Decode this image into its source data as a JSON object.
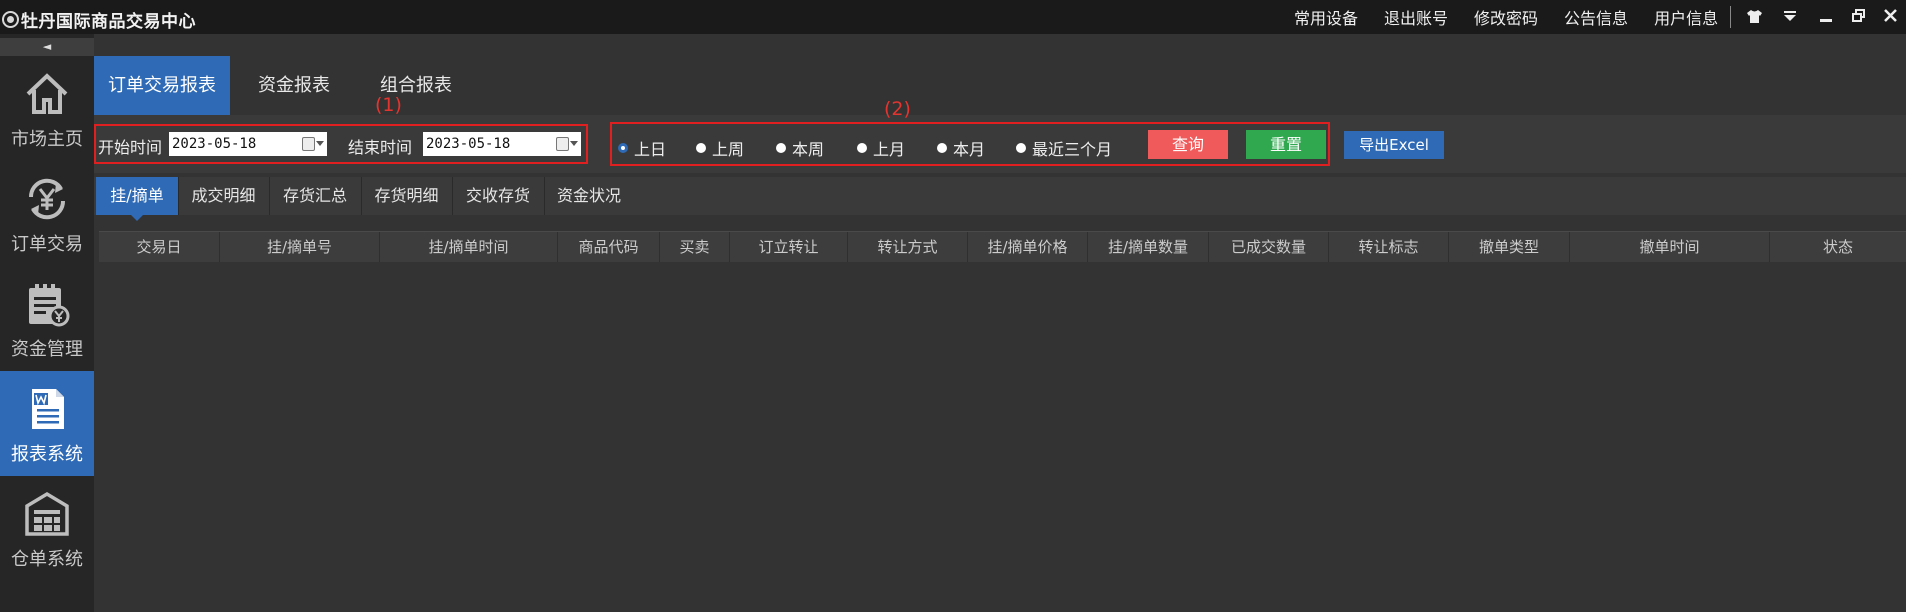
{
  "app": {
    "title": "牡丹国际商品交易中心"
  },
  "topmenu": [
    "常用设备",
    "退出账号",
    "修改密码",
    "公告信息",
    "用户信息"
  ],
  "window_icons": [
    "shirt-icon",
    "dropdown-icon",
    "minimize-icon",
    "restore-icon",
    "close-icon"
  ],
  "sidebar": {
    "collapse": "◄",
    "items": [
      {
        "label": "市场主页",
        "icon": "home-icon",
        "active": false
      },
      {
        "label": "订单交易",
        "icon": "yen-exchange-icon",
        "active": false
      },
      {
        "label": "资金管理",
        "icon": "clipboard-yen-icon",
        "active": false
      },
      {
        "label": "报表系统",
        "icon": "word-document-icon",
        "active": true
      },
      {
        "label": "仓单系统",
        "icon": "warehouse-icon",
        "active": false
      }
    ]
  },
  "report_tabs": [
    "订单交易报表",
    "资金报表",
    "组合报表"
  ],
  "annotations": {
    "one": "(1)",
    "two": "(2)"
  },
  "filters": {
    "start_label": "开始时间",
    "start_value": "2023-05-18",
    "end_label": "结束时间",
    "end_value": "2023-05-18",
    "periods": [
      "上日",
      "上周",
      "本周",
      "上月",
      "本月",
      "最近三个月"
    ],
    "selected_period": "上日",
    "query_label": "查询",
    "reset_label": "重置",
    "export_label": "导出Excel"
  },
  "sub_tabs": [
    "挂/摘单",
    "成交明细",
    "存货汇总",
    "存货明细",
    "交收存货",
    "资金状况"
  ],
  "table_headers": [
    "交易日",
    "挂/摘单号",
    "挂/摘单时间",
    "商品代码",
    "买卖",
    "订立转让",
    "转让方式",
    "挂/摘单价格",
    "挂/摘单数量",
    "已成交数量",
    "转让标志",
    "撤单类型",
    "撤单时间",
    "状态"
  ],
  "colors": {
    "accent": "#2e6ab5",
    "query": "#f05a5a",
    "reset": "#2fa84f",
    "annotation": "#e02020"
  }
}
